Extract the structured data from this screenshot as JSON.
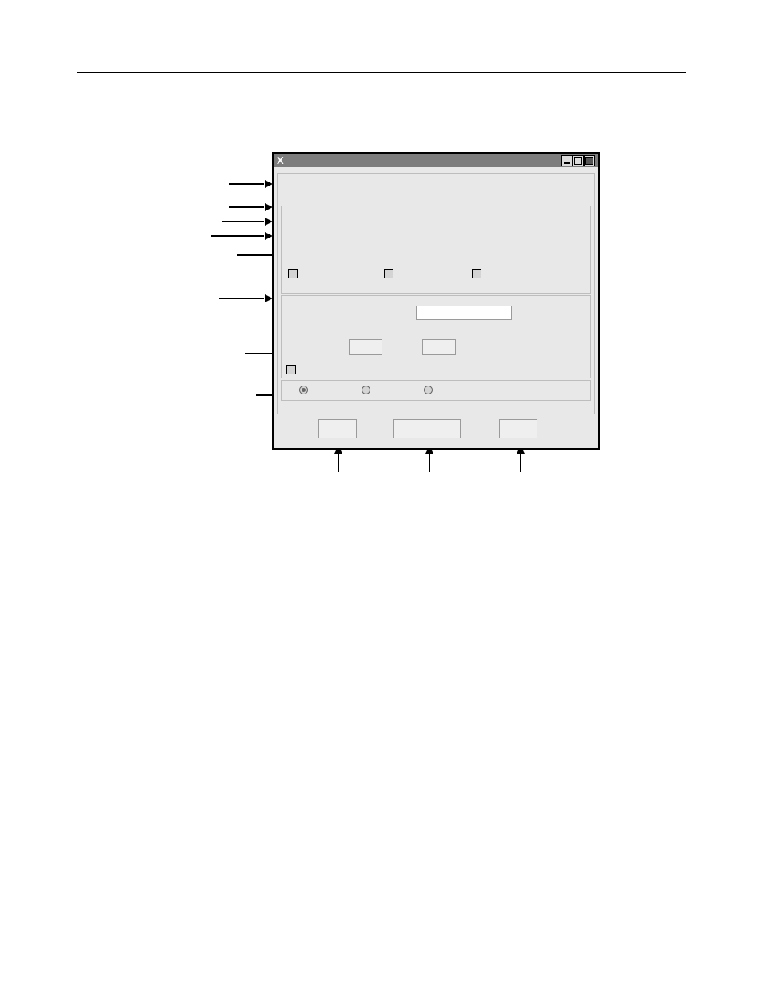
{
  "titlebar": {
    "system_mark": "X"
  },
  "window_controls": {
    "minimize": "minimize",
    "maximize": "maximize",
    "close": "close"
  },
  "groupbox1": {
    "checkboxes": [
      {
        "label": ""
      },
      {
        "label": ""
      },
      {
        "label": ""
      }
    ]
  },
  "groupbox2": {
    "textfield_value": "",
    "numeric1_value": "",
    "numeric2_value": "",
    "checkbox_label": ""
  },
  "groupbox3": {
    "radios": [
      {
        "label": "",
        "selected": true
      },
      {
        "label": "",
        "selected": false
      },
      {
        "label": "",
        "selected": false
      }
    ]
  },
  "buttons": {
    "b1_label": "",
    "b2_label": "",
    "b3_label": ""
  }
}
